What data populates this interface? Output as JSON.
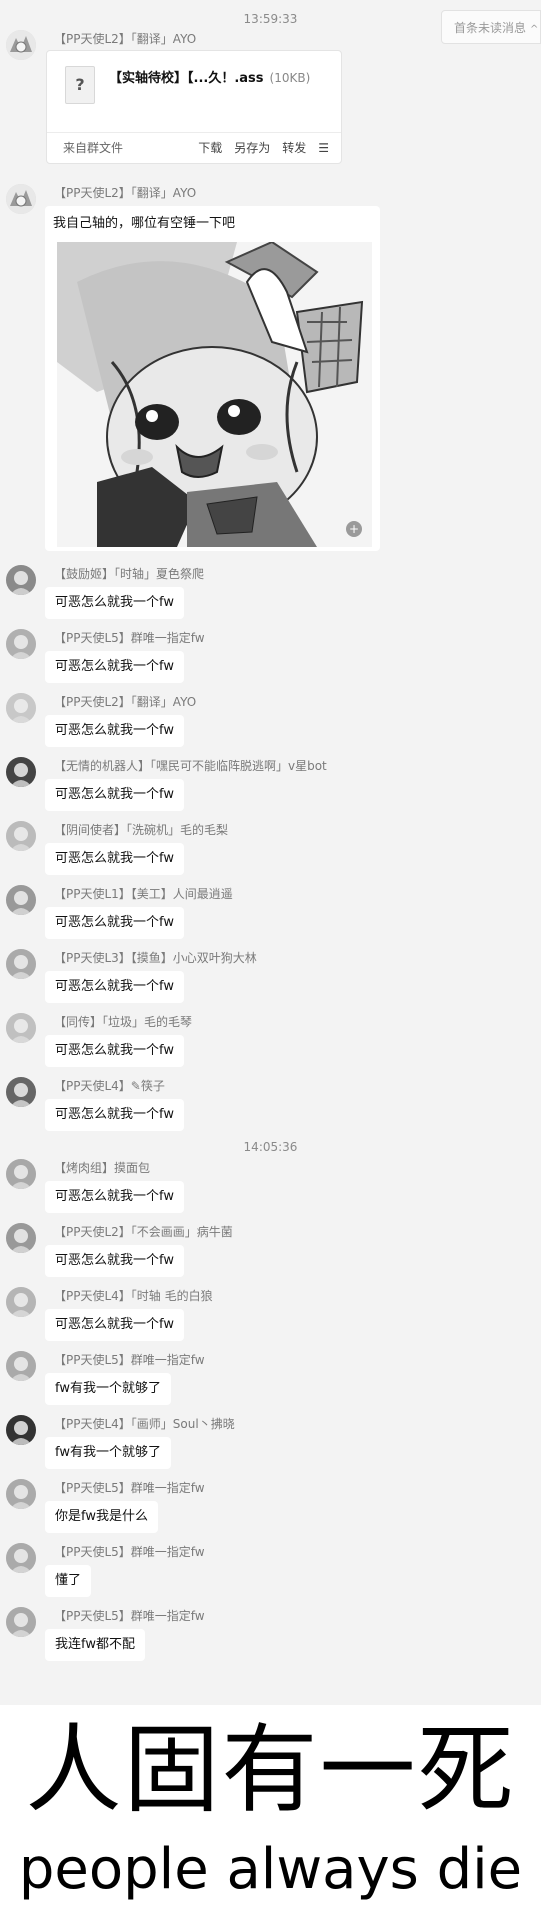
{
  "topbar": {
    "unread_label": "首条未读消息",
    "chevron": "^"
  },
  "timestamps": [
    "13:59:33",
    "14:05:36"
  ],
  "file_message": {
    "sender": "【PP天使L2】「翻译」AYO",
    "file_icon": "?",
    "file_name": "【实轴待校】【...久！.ass",
    "file_size": "(10KB)",
    "source": "来自群文件",
    "actions": [
      "下载",
      "另存为",
      "转发",
      "☰"
    ]
  },
  "image_message": {
    "sender": "【PP天使L2】「翻译」AYO",
    "text": "我自己轴的，哪位有空锤一下吧",
    "image_icon": "manga-character-image",
    "zoom": "+"
  },
  "messages": [
    {
      "sender": "【鼓励姬】「时轴」夏色祭爬",
      "text": "可恶怎么就我一个fw"
    },
    {
      "sender": "【PP天使L5】群唯一指定fw",
      "text": "可恶怎么就我一个fw"
    },
    {
      "sender": "【PP天使L2】「翻译」AYO",
      "text": "可恶怎么就我一个fw"
    },
    {
      "sender": "【无情的机器人】「嘿民可不能临阵脱逃啊」v星bot",
      "text": "可恶怎么就我一个fw"
    },
    {
      "sender": "【阴间使者】「洗碗机」毛的毛梨",
      "text": "可恶怎么就我一个fw"
    },
    {
      "sender": "【PP天使L1】【美工】人间最逍遥",
      "text": "可恶怎么就我一个fw"
    },
    {
      "sender": "【PP天使L3】【摸鱼】小心双叶狗大林",
      "text": "可恶怎么就我一个fw"
    },
    {
      "sender": "【同传】「垃圾」毛的毛琴",
      "text": "可恶怎么就我一个fw"
    },
    {
      "sender": "【PP天使L4】✎筷子",
      "text": "可恶怎么就我一个fw"
    },
    {
      "sender": "【烤肉组】摸面包",
      "text": "可恶怎么就我一个fw"
    },
    {
      "sender": "【PP天使L2】「不会画画」病牛菌",
      "text": "可恶怎么就我一个fw"
    },
    {
      "sender": "【PP天使L4】「时轴 毛的白狼",
      "text": "可恶怎么就我一个fw"
    },
    {
      "sender": "【PP天使L5】群唯一指定fw",
      "text": "fw有我一个就够了"
    },
    {
      "sender": "【PP天使L4】「画师」Soul丶拂晓",
      "text": "fw有我一个就够了"
    },
    {
      "sender": "【PP天使L5】群唯一指定fw",
      "text": "你是fw我是什么"
    },
    {
      "sender": "【PP天使L5】群唯一指定fw",
      "text": "懂了"
    },
    {
      "sender": "【PP天使L5】群唯一指定fw",
      "text": "我连fw都不配"
    }
  ],
  "caption": {
    "chinese": "人固有一死",
    "english": "people always die"
  }
}
